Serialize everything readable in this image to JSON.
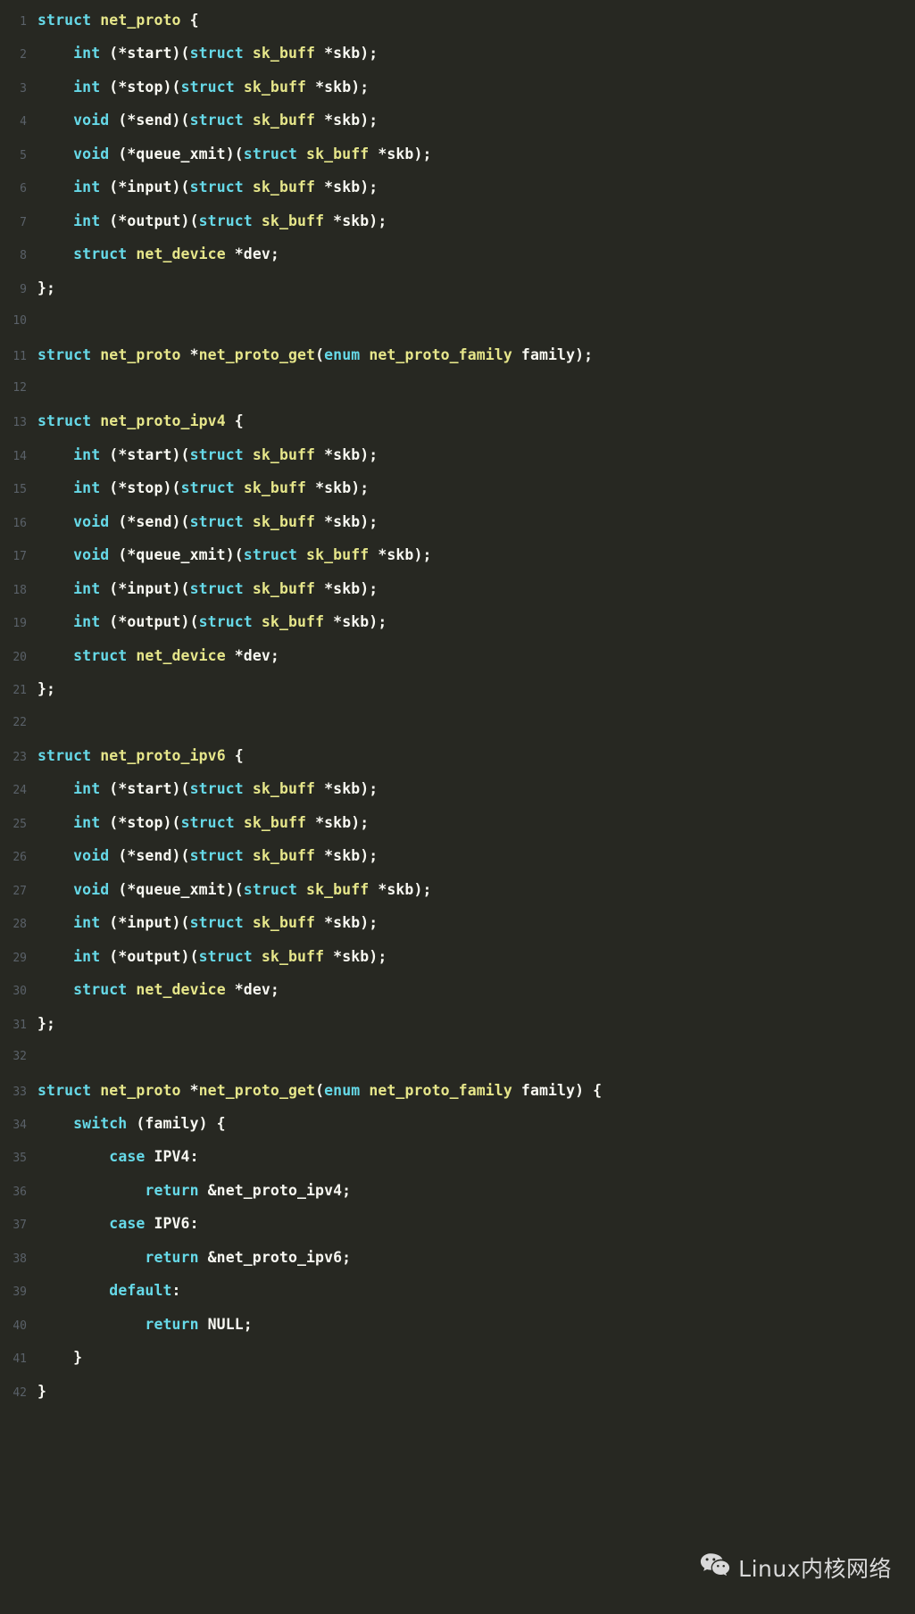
{
  "editor": {
    "theme": "monokai-dark",
    "background_color": "#272822",
    "line_number_color": "#5a6169",
    "colors": {
      "keyword": "#66d9e8",
      "identifier": "#e6e68a",
      "plain": "#f8f8f2"
    },
    "lines": [
      {
        "number": "1",
        "tokens": [
          {
            "t": "struct",
            "c": "kw"
          },
          {
            "t": " ",
            "c": "pl"
          },
          {
            "t": "net_proto",
            "c": "id"
          },
          {
            "t": " {",
            "c": "pl"
          }
        ]
      },
      {
        "number": "2",
        "tokens": [
          {
            "t": "    ",
            "c": "pl"
          },
          {
            "t": "int",
            "c": "kw"
          },
          {
            "t": " (*start)(",
            "c": "pl"
          },
          {
            "t": "struct",
            "c": "kw"
          },
          {
            "t": " ",
            "c": "pl"
          },
          {
            "t": "sk_buff",
            "c": "id"
          },
          {
            "t": " *skb);",
            "c": "pl"
          }
        ]
      },
      {
        "number": "3",
        "tokens": [
          {
            "t": "    ",
            "c": "pl"
          },
          {
            "t": "int",
            "c": "kw"
          },
          {
            "t": " (*stop)(",
            "c": "pl"
          },
          {
            "t": "struct",
            "c": "kw"
          },
          {
            "t": " ",
            "c": "pl"
          },
          {
            "t": "sk_buff",
            "c": "id"
          },
          {
            "t": " *skb);",
            "c": "pl"
          }
        ]
      },
      {
        "number": "4",
        "tokens": [
          {
            "t": "    ",
            "c": "pl"
          },
          {
            "t": "void",
            "c": "kw"
          },
          {
            "t": " (*send)(",
            "c": "pl"
          },
          {
            "t": "struct",
            "c": "kw"
          },
          {
            "t": " ",
            "c": "pl"
          },
          {
            "t": "sk_buff",
            "c": "id"
          },
          {
            "t": " *skb);",
            "c": "pl"
          }
        ]
      },
      {
        "number": "5",
        "tokens": [
          {
            "t": "    ",
            "c": "pl"
          },
          {
            "t": "void",
            "c": "kw"
          },
          {
            "t": " (*queue_xmit)(",
            "c": "pl"
          },
          {
            "t": "struct",
            "c": "kw"
          },
          {
            "t": " ",
            "c": "pl"
          },
          {
            "t": "sk_buff",
            "c": "id"
          },
          {
            "t": " *skb);",
            "c": "pl"
          }
        ]
      },
      {
        "number": "6",
        "tokens": [
          {
            "t": "    ",
            "c": "pl"
          },
          {
            "t": "int",
            "c": "kw"
          },
          {
            "t": " (*input)(",
            "c": "pl"
          },
          {
            "t": "struct",
            "c": "kw"
          },
          {
            "t": " ",
            "c": "pl"
          },
          {
            "t": "sk_buff",
            "c": "id"
          },
          {
            "t": " *skb);",
            "c": "pl"
          }
        ]
      },
      {
        "number": "7",
        "tokens": [
          {
            "t": "    ",
            "c": "pl"
          },
          {
            "t": "int",
            "c": "kw"
          },
          {
            "t": " (*output)(",
            "c": "pl"
          },
          {
            "t": "struct",
            "c": "kw"
          },
          {
            "t": " ",
            "c": "pl"
          },
          {
            "t": "sk_buff",
            "c": "id"
          },
          {
            "t": " *skb);",
            "c": "pl"
          }
        ]
      },
      {
        "number": "8",
        "tokens": [
          {
            "t": "    ",
            "c": "pl"
          },
          {
            "t": "struct",
            "c": "kw"
          },
          {
            "t": " ",
            "c": "pl"
          },
          {
            "t": "net_device",
            "c": "id"
          },
          {
            "t": " *dev;",
            "c": "pl"
          }
        ]
      },
      {
        "number": "9",
        "tokens": [
          {
            "t": "};",
            "c": "pl"
          }
        ]
      },
      {
        "number": "10",
        "tokens": []
      },
      {
        "number": "11",
        "tokens": [
          {
            "t": "struct",
            "c": "kw"
          },
          {
            "t": " ",
            "c": "pl"
          },
          {
            "t": "net_proto",
            "c": "id"
          },
          {
            "t": " *",
            "c": "pl"
          },
          {
            "t": "net_proto_get",
            "c": "id"
          },
          {
            "t": "(",
            "c": "pl"
          },
          {
            "t": "enum",
            "c": "kw"
          },
          {
            "t": " ",
            "c": "pl"
          },
          {
            "t": "net_proto_family",
            "c": "id"
          },
          {
            "t": " family);",
            "c": "pl"
          }
        ]
      },
      {
        "number": "12",
        "tokens": []
      },
      {
        "number": "13",
        "tokens": [
          {
            "t": "struct",
            "c": "kw"
          },
          {
            "t": " ",
            "c": "pl"
          },
          {
            "t": "net_proto_ipv4",
            "c": "id"
          },
          {
            "t": " {",
            "c": "pl"
          }
        ]
      },
      {
        "number": "14",
        "tokens": [
          {
            "t": "    ",
            "c": "pl"
          },
          {
            "t": "int",
            "c": "kw"
          },
          {
            "t": " (*start)(",
            "c": "pl"
          },
          {
            "t": "struct",
            "c": "kw"
          },
          {
            "t": " ",
            "c": "pl"
          },
          {
            "t": "sk_buff",
            "c": "id"
          },
          {
            "t": " *skb);",
            "c": "pl"
          }
        ]
      },
      {
        "number": "15",
        "tokens": [
          {
            "t": "    ",
            "c": "pl"
          },
          {
            "t": "int",
            "c": "kw"
          },
          {
            "t": " (*stop)(",
            "c": "pl"
          },
          {
            "t": "struct",
            "c": "kw"
          },
          {
            "t": " ",
            "c": "pl"
          },
          {
            "t": "sk_buff",
            "c": "id"
          },
          {
            "t": " *skb);",
            "c": "pl"
          }
        ]
      },
      {
        "number": "16",
        "tokens": [
          {
            "t": "    ",
            "c": "pl"
          },
          {
            "t": "void",
            "c": "kw"
          },
          {
            "t": " (*send)(",
            "c": "pl"
          },
          {
            "t": "struct",
            "c": "kw"
          },
          {
            "t": " ",
            "c": "pl"
          },
          {
            "t": "sk_buff",
            "c": "id"
          },
          {
            "t": " *skb);",
            "c": "pl"
          }
        ]
      },
      {
        "number": "17",
        "tokens": [
          {
            "t": "    ",
            "c": "pl"
          },
          {
            "t": "void",
            "c": "kw"
          },
          {
            "t": " (*queue_xmit)(",
            "c": "pl"
          },
          {
            "t": "struct",
            "c": "kw"
          },
          {
            "t": " ",
            "c": "pl"
          },
          {
            "t": "sk_buff",
            "c": "id"
          },
          {
            "t": " *skb);",
            "c": "pl"
          }
        ]
      },
      {
        "number": "18",
        "tokens": [
          {
            "t": "    ",
            "c": "pl"
          },
          {
            "t": "int",
            "c": "kw"
          },
          {
            "t": " (*input)(",
            "c": "pl"
          },
          {
            "t": "struct",
            "c": "kw"
          },
          {
            "t": " ",
            "c": "pl"
          },
          {
            "t": "sk_buff",
            "c": "id"
          },
          {
            "t": " *skb);",
            "c": "pl"
          }
        ]
      },
      {
        "number": "19",
        "tokens": [
          {
            "t": "    ",
            "c": "pl"
          },
          {
            "t": "int",
            "c": "kw"
          },
          {
            "t": " (*output)(",
            "c": "pl"
          },
          {
            "t": "struct",
            "c": "kw"
          },
          {
            "t": " ",
            "c": "pl"
          },
          {
            "t": "sk_buff",
            "c": "id"
          },
          {
            "t": " *skb);",
            "c": "pl"
          }
        ]
      },
      {
        "number": "20",
        "tokens": [
          {
            "t": "    ",
            "c": "pl"
          },
          {
            "t": "struct",
            "c": "kw"
          },
          {
            "t": " ",
            "c": "pl"
          },
          {
            "t": "net_device",
            "c": "id"
          },
          {
            "t": " *dev;",
            "c": "pl"
          }
        ]
      },
      {
        "number": "21",
        "tokens": [
          {
            "t": "};",
            "c": "pl"
          }
        ]
      },
      {
        "number": "22",
        "tokens": []
      },
      {
        "number": "23",
        "tokens": [
          {
            "t": "struct",
            "c": "kw"
          },
          {
            "t": " ",
            "c": "pl"
          },
          {
            "t": "net_proto_ipv6",
            "c": "id"
          },
          {
            "t": " {",
            "c": "pl"
          }
        ]
      },
      {
        "number": "24",
        "tokens": [
          {
            "t": "    ",
            "c": "pl"
          },
          {
            "t": "int",
            "c": "kw"
          },
          {
            "t": " (*start)(",
            "c": "pl"
          },
          {
            "t": "struct",
            "c": "kw"
          },
          {
            "t": " ",
            "c": "pl"
          },
          {
            "t": "sk_buff",
            "c": "id"
          },
          {
            "t": " *skb);",
            "c": "pl"
          }
        ]
      },
      {
        "number": "25",
        "tokens": [
          {
            "t": "    ",
            "c": "pl"
          },
          {
            "t": "int",
            "c": "kw"
          },
          {
            "t": " (*stop)(",
            "c": "pl"
          },
          {
            "t": "struct",
            "c": "kw"
          },
          {
            "t": " ",
            "c": "pl"
          },
          {
            "t": "sk_buff",
            "c": "id"
          },
          {
            "t": " *skb);",
            "c": "pl"
          }
        ]
      },
      {
        "number": "26",
        "tokens": [
          {
            "t": "    ",
            "c": "pl"
          },
          {
            "t": "void",
            "c": "kw"
          },
          {
            "t": " (*send)(",
            "c": "pl"
          },
          {
            "t": "struct",
            "c": "kw"
          },
          {
            "t": " ",
            "c": "pl"
          },
          {
            "t": "sk_buff",
            "c": "id"
          },
          {
            "t": " *skb);",
            "c": "pl"
          }
        ]
      },
      {
        "number": "27",
        "tokens": [
          {
            "t": "    ",
            "c": "pl"
          },
          {
            "t": "void",
            "c": "kw"
          },
          {
            "t": " (*queue_xmit)(",
            "c": "pl"
          },
          {
            "t": "struct",
            "c": "kw"
          },
          {
            "t": " ",
            "c": "pl"
          },
          {
            "t": "sk_buff",
            "c": "id"
          },
          {
            "t": " *skb);",
            "c": "pl"
          }
        ]
      },
      {
        "number": "28",
        "tokens": [
          {
            "t": "    ",
            "c": "pl"
          },
          {
            "t": "int",
            "c": "kw"
          },
          {
            "t": " (*input)(",
            "c": "pl"
          },
          {
            "t": "struct",
            "c": "kw"
          },
          {
            "t": " ",
            "c": "pl"
          },
          {
            "t": "sk_buff",
            "c": "id"
          },
          {
            "t": " *skb);",
            "c": "pl"
          }
        ]
      },
      {
        "number": "29",
        "tokens": [
          {
            "t": "    ",
            "c": "pl"
          },
          {
            "t": "int",
            "c": "kw"
          },
          {
            "t": " (*output)(",
            "c": "pl"
          },
          {
            "t": "struct",
            "c": "kw"
          },
          {
            "t": " ",
            "c": "pl"
          },
          {
            "t": "sk_buff",
            "c": "id"
          },
          {
            "t": " *skb);",
            "c": "pl"
          }
        ]
      },
      {
        "number": "30",
        "tokens": [
          {
            "t": "    ",
            "c": "pl"
          },
          {
            "t": "struct",
            "c": "kw"
          },
          {
            "t": " ",
            "c": "pl"
          },
          {
            "t": "net_device",
            "c": "id"
          },
          {
            "t": " *dev;",
            "c": "pl"
          }
        ]
      },
      {
        "number": "31",
        "tokens": [
          {
            "t": "};",
            "c": "pl"
          }
        ]
      },
      {
        "number": "32",
        "tokens": []
      },
      {
        "number": "33",
        "tokens": [
          {
            "t": "struct",
            "c": "kw"
          },
          {
            "t": " ",
            "c": "pl"
          },
          {
            "t": "net_proto",
            "c": "id"
          },
          {
            "t": " *",
            "c": "pl"
          },
          {
            "t": "net_proto_get",
            "c": "id"
          },
          {
            "t": "(",
            "c": "pl"
          },
          {
            "t": "enum",
            "c": "kw"
          },
          {
            "t": " ",
            "c": "pl"
          },
          {
            "t": "net_proto_family",
            "c": "id"
          },
          {
            "t": " family) {",
            "c": "pl"
          }
        ]
      },
      {
        "number": "34",
        "tokens": [
          {
            "t": "    ",
            "c": "pl"
          },
          {
            "t": "switch",
            "c": "kw"
          },
          {
            "t": " (family) {",
            "c": "pl"
          }
        ]
      },
      {
        "number": "35",
        "tokens": [
          {
            "t": "        ",
            "c": "pl"
          },
          {
            "t": "case",
            "c": "kw"
          },
          {
            "t": " IPV4:",
            "c": "pl"
          }
        ]
      },
      {
        "number": "36",
        "tokens": [
          {
            "t": "            ",
            "c": "pl"
          },
          {
            "t": "return",
            "c": "kw"
          },
          {
            "t": " &net_proto_ipv4;",
            "c": "pl"
          }
        ]
      },
      {
        "number": "37",
        "tokens": [
          {
            "t": "        ",
            "c": "pl"
          },
          {
            "t": "case",
            "c": "kw"
          },
          {
            "t": " IPV6:",
            "c": "pl"
          }
        ]
      },
      {
        "number": "38",
        "tokens": [
          {
            "t": "            ",
            "c": "pl"
          },
          {
            "t": "return",
            "c": "kw"
          },
          {
            "t": " &net_proto_ipv6;",
            "c": "pl"
          }
        ]
      },
      {
        "number": "39",
        "tokens": [
          {
            "t": "        ",
            "c": "pl"
          },
          {
            "t": "default",
            "c": "kw"
          },
          {
            "t": ":",
            "c": "pl"
          }
        ]
      },
      {
        "number": "40",
        "tokens": [
          {
            "t": "            ",
            "c": "pl"
          },
          {
            "t": "return",
            "c": "kw"
          },
          {
            "t": " NULL;",
            "c": "pl"
          }
        ]
      },
      {
        "number": "41",
        "tokens": [
          {
            "t": "    }",
            "c": "pl"
          }
        ]
      },
      {
        "number": "42",
        "tokens": [
          {
            "t": "}",
            "c": "pl"
          }
        ]
      }
    ]
  },
  "watermark": {
    "icon": "wechat-icon",
    "label": "Linux内核网络",
    "text_color": "#d9d9d9"
  }
}
